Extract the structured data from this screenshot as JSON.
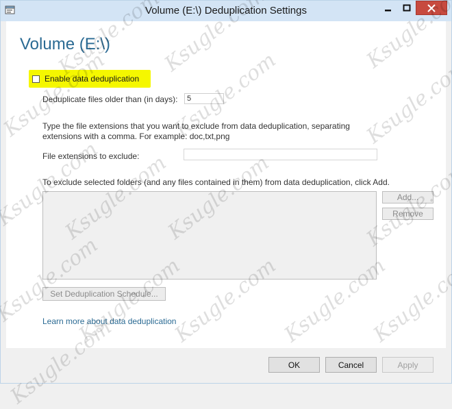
{
  "window": {
    "title": "Volume (E:\\) Deduplication Settings",
    "icons": {
      "app": "settings-window-icon",
      "minimize": "minimize-icon",
      "maximize": "maximize-icon",
      "close": "close-icon"
    },
    "colors": {
      "titlebar": "#d3e4f5",
      "close_button": "#c74a3f",
      "heading": "#2a6a93",
      "highlight": "#f5f700"
    }
  },
  "content": {
    "heading": "Volume (E:\\)",
    "enable_checkbox": {
      "label": "Enable data deduplication",
      "checked": false
    },
    "days": {
      "label": "Deduplicate files older than (in days):",
      "value": "5"
    },
    "extensions": {
      "help_line1": "Type the file extensions that you want to exclude from data deduplication, separating",
      "help_line2": "extensions with a comma. For example: doc,txt,png",
      "label": "File extensions to exclude:",
      "value": ""
    },
    "folders": {
      "help": "To exclude selected folders (and any files contained in them) from data deduplication, click Add.",
      "add_label": "Add...",
      "remove_label": "Remove"
    },
    "schedule_button": "Set Deduplication Schedule...",
    "learn_link": "Learn more about data deduplication"
  },
  "footer": {
    "ok": "OK",
    "cancel": "Cancel",
    "apply": "Apply"
  },
  "watermark": "Ksugle.com"
}
